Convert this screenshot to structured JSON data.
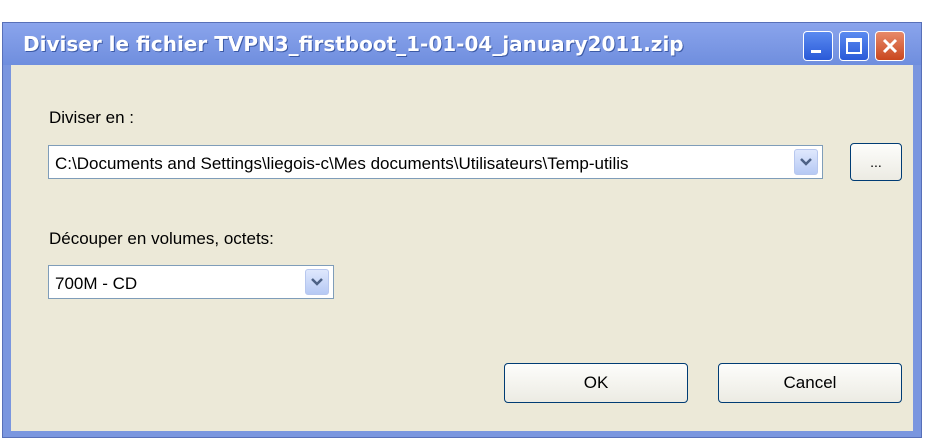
{
  "window": {
    "title": "Diviser le fichier TVPN3_firstboot_1-01-04_january2011.zip"
  },
  "split_to": {
    "label": "Diviser en :",
    "path_value": "C:\\Documents and Settings\\liegois-c\\Mes documents\\Utilisateurs\\Temp-utilis",
    "browse_label": "..."
  },
  "volumes": {
    "label": "Découper en volumes, octets:",
    "selected": "700M - CD"
  },
  "buttons": {
    "ok": "OK",
    "cancel": "Cancel"
  },
  "icons": {
    "minimize": "minimize-icon",
    "maximize": "maximize-icon",
    "close": "close-icon",
    "dropdown": "chevron-down-icon"
  },
  "colors": {
    "title_bar": "#7a96df",
    "dialog_bg": "#ece9d8",
    "close_button": "#c9471f"
  }
}
